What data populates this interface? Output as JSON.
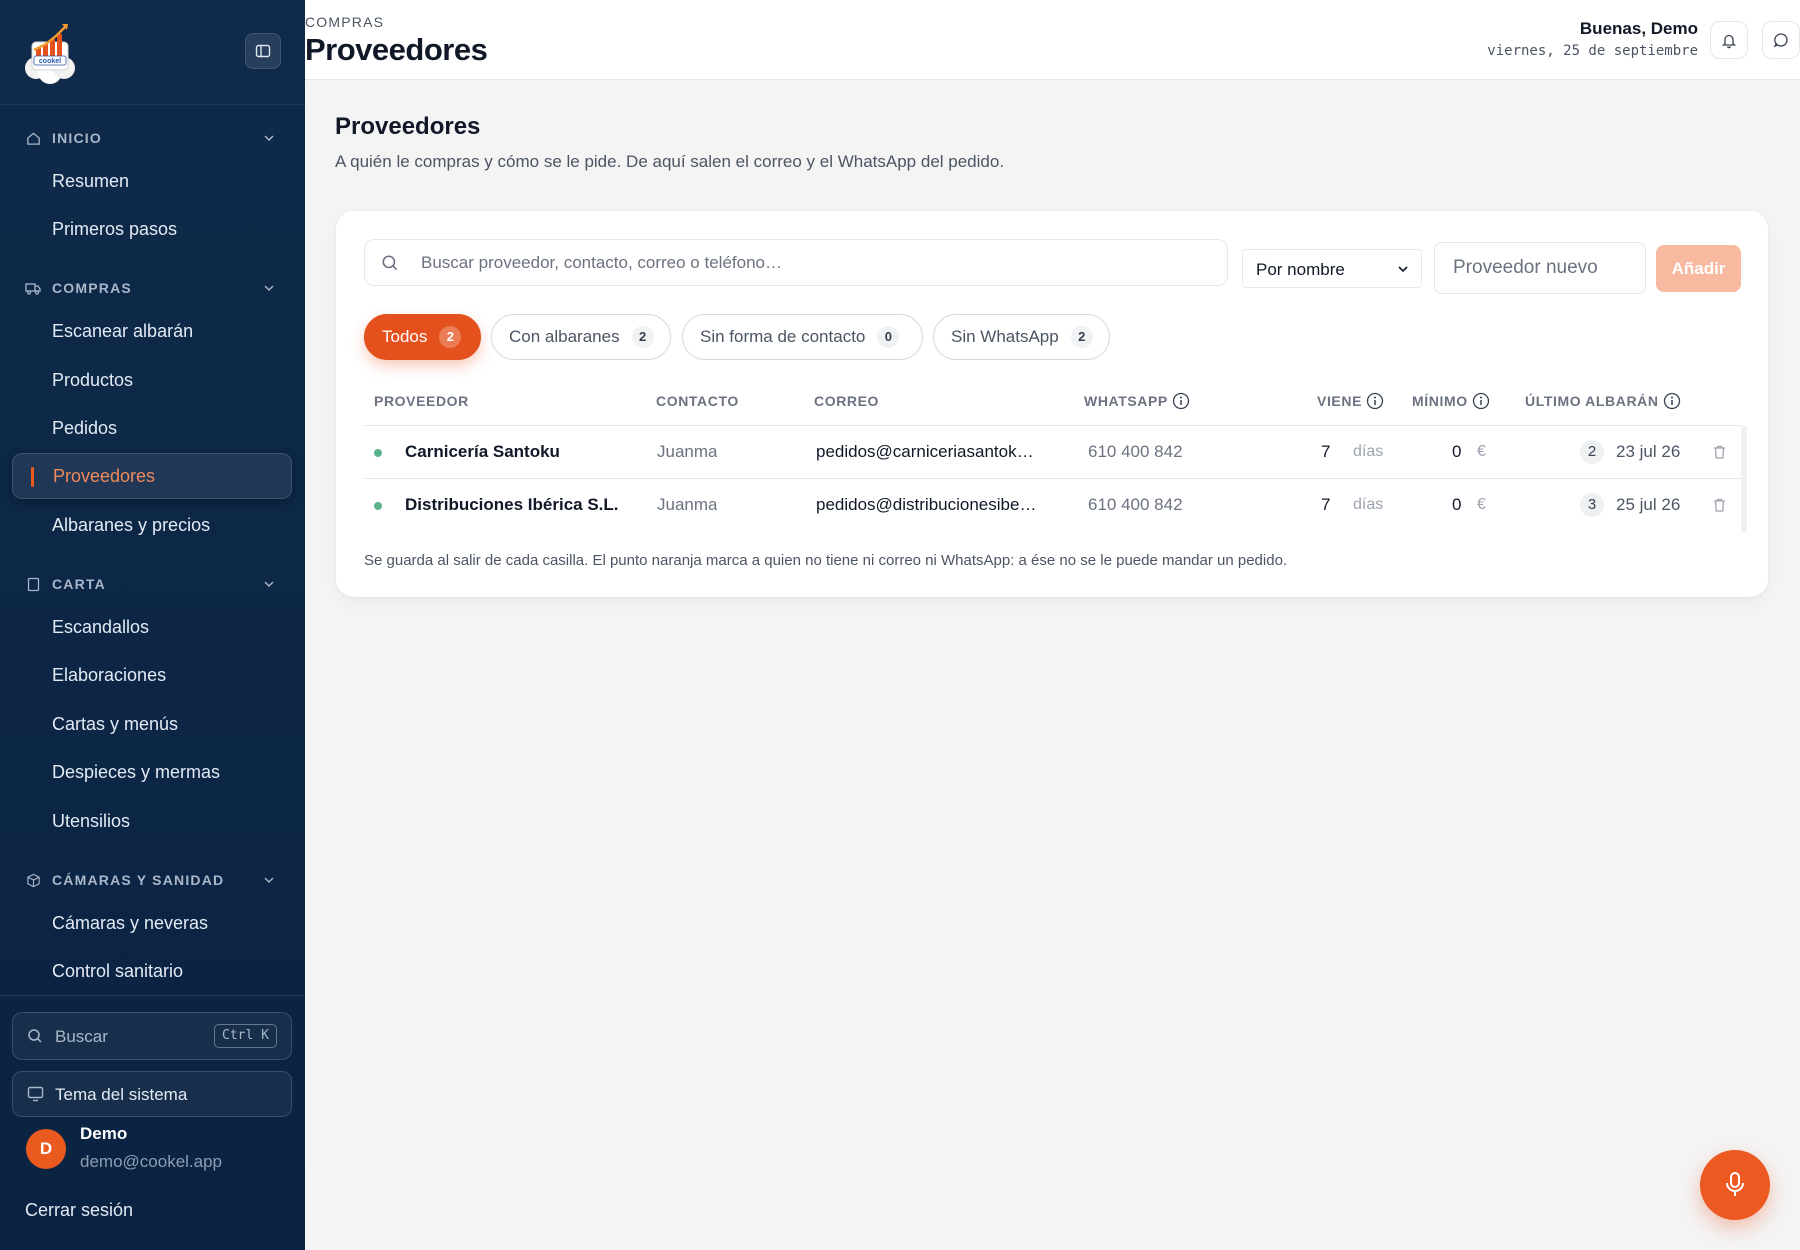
{
  "sidebar": {
    "sections": [
      {
        "label": "INICIO",
        "icon": "home-icon",
        "items": [
          "Resumen",
          "Primeros pasos"
        ]
      },
      {
        "label": "COMPRAS",
        "icon": "truck-icon",
        "items": [
          "Escanear albarán",
          "Productos",
          "Pedidos",
          "Proveedores",
          "Albaranes y precios"
        ]
      },
      {
        "label": "CARTA",
        "icon": "book-icon",
        "items": [
          "Escandallos",
          "Elaboraciones",
          "Cartas y menús",
          "Despieces y mermas",
          "Utensilios"
        ]
      },
      {
        "label": "CÁMARAS Y SANIDAD",
        "icon": "box-icon",
        "items": [
          "Cámaras y neveras",
          "Control sanitario"
        ]
      }
    ],
    "active_item": "Proveedores",
    "search_label": "Buscar",
    "search_shortcut": "Ctrl K",
    "theme_label": "Tema del sistema",
    "user": {
      "initial": "D",
      "name": "Demo",
      "email": "demo@cookel.app"
    },
    "logout_label": "Cerrar sesión"
  },
  "header": {
    "breadcrumb": "COMPRAS",
    "title": "Proveedores",
    "greeting": "Buenas, Demo",
    "date": "viernes, 25 de septiembre"
  },
  "main": {
    "heading": "Proveedores",
    "subtitle": "A quién le compras y cómo se le pide. De aquí salen el correo y el WhatsApp del pedido.",
    "search_placeholder": "Buscar proveedor, contacto, correo o teléfono…",
    "sort_value": "Por nombre",
    "new_placeholder": "Proveedor nuevo",
    "add_label": "Añadir",
    "filters": [
      {
        "label": "Todos",
        "count": "2"
      },
      {
        "label": "Con albaranes",
        "count": "2"
      },
      {
        "label": "Sin forma de contacto",
        "count": "0"
      },
      {
        "label": "Sin WhatsApp",
        "count": "2"
      }
    ],
    "columns": {
      "proveedor": "PROVEEDOR",
      "contacto": "CONTACTO",
      "correo": "CORREO",
      "whatsapp": "WHATSAPP",
      "viene": "VIENE",
      "minimo": "MÍNIMO",
      "ultimo": "ÚLTIMO ALBARÁN"
    },
    "rows": [
      {
        "name": "Carnicería Santoku",
        "contact": "Juanma",
        "email": "pedidos@carniceriasantoku.es",
        "phone": "610 400 842",
        "days": "7",
        "days_unit": "días",
        "minimum": "0",
        "currency": "€",
        "albaranes": "2",
        "last_date": "23 jul 26"
      },
      {
        "name": "Distribuciones Ibérica S.L.",
        "contact": "Juanma",
        "email": "pedidos@distribucionesibericas.es",
        "phone": "610 400 842",
        "days": "7",
        "days_unit": "días",
        "minimum": "0",
        "currency": "€",
        "albaranes": "3",
        "last_date": "25 jul 26"
      }
    ],
    "note": "Se guarda al salir de cada casilla. El punto naranja marca a quien no tiene ni correo ni WhatsApp: a ése no se le puede mandar un pedido."
  },
  "colors": {
    "sidebar_bg": "#0f2a4a",
    "accent": "#e4511d",
    "status_ok": "#5cb38b"
  }
}
